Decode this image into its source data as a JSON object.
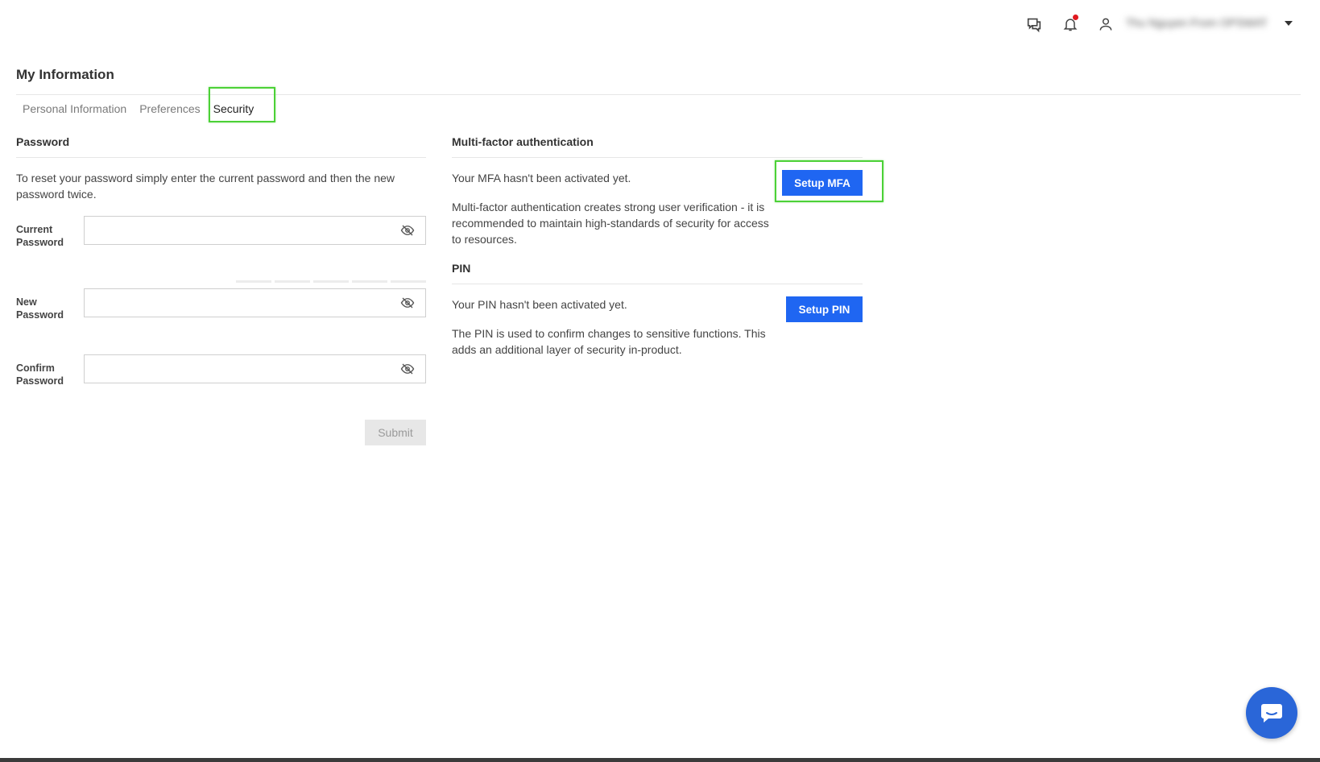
{
  "header": {
    "user_name": "Thu Nguyen From OPSWAT ...",
    "icons": [
      "messages-icon",
      "bell-icon",
      "user-icon",
      "caret-down-icon"
    ]
  },
  "page": {
    "title": "My Information"
  },
  "tabs": [
    {
      "label": "Personal Information",
      "active": false
    },
    {
      "label": "Preferences",
      "active": false
    },
    {
      "label": "Security",
      "active": true
    }
  ],
  "password": {
    "title": "Password",
    "description": "To reset your password simply enter the current password and then the new password twice.",
    "current_label_1": "Current",
    "current_label_2": "Password",
    "new_label_1": "New",
    "new_label_2": "Password",
    "confirm_label_1": "Confirm",
    "confirm_label_2": "Password",
    "current_value": "",
    "new_value": "",
    "confirm_value": "",
    "submit_label": "Submit"
  },
  "mfa": {
    "title": "Multi-factor authentication",
    "status": "Your MFA hasn't been activated yet.",
    "description": "Multi-factor authentication creates strong user verification - it is recommended to maintain high-standards of security for access to resources.",
    "button_label": "Setup MFA"
  },
  "pin": {
    "title": "PIN",
    "status": "Your PIN hasn't been activated yet.",
    "description": "The PIN is used to confirm changes to sensitive functions. This adds an additional layer of security in-product.",
    "button_label": "Setup PIN"
  },
  "colors": {
    "primary": "#1f66f2",
    "highlight": "#4cd137",
    "notification": "#e0191f",
    "chat_fab": "#2a66d8"
  }
}
